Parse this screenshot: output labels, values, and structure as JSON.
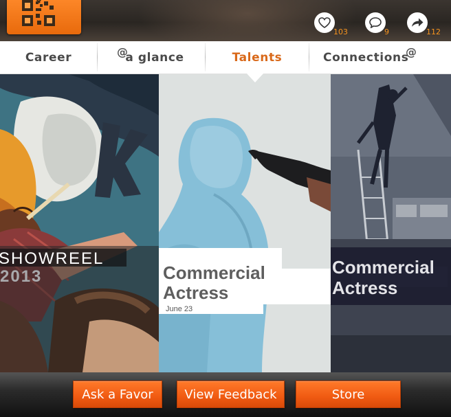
{
  "header": {
    "stats": [
      {
        "icon": "heart-icon",
        "count": "103"
      },
      {
        "icon": "comment-icon",
        "count": "9"
      },
      {
        "icon": "share-icon",
        "count": "112"
      }
    ]
  },
  "tabs": [
    {
      "label": "Career"
    },
    {
      "label": "a glance",
      "prefix": "@"
    },
    {
      "label": "Talents",
      "active": true
    },
    {
      "label": "Connections",
      "suffix": "@"
    }
  ],
  "panels": {
    "left": {
      "line1": "SHOWREEL",
      "line2": "2013"
    },
    "middle": {
      "line1": "Commercial",
      "line2": "Actress",
      "date": "June 23"
    },
    "right": {
      "line1": "Commercial",
      "line2": "Actress"
    }
  },
  "bottom_buttons": [
    {
      "label": "Ask a Favor"
    },
    {
      "label": "View Feedback"
    },
    {
      "label": "Store"
    }
  ],
  "colors": {
    "accent": "#f05a12",
    "active_tab": "#d9691a",
    "count": "#f7941e"
  }
}
